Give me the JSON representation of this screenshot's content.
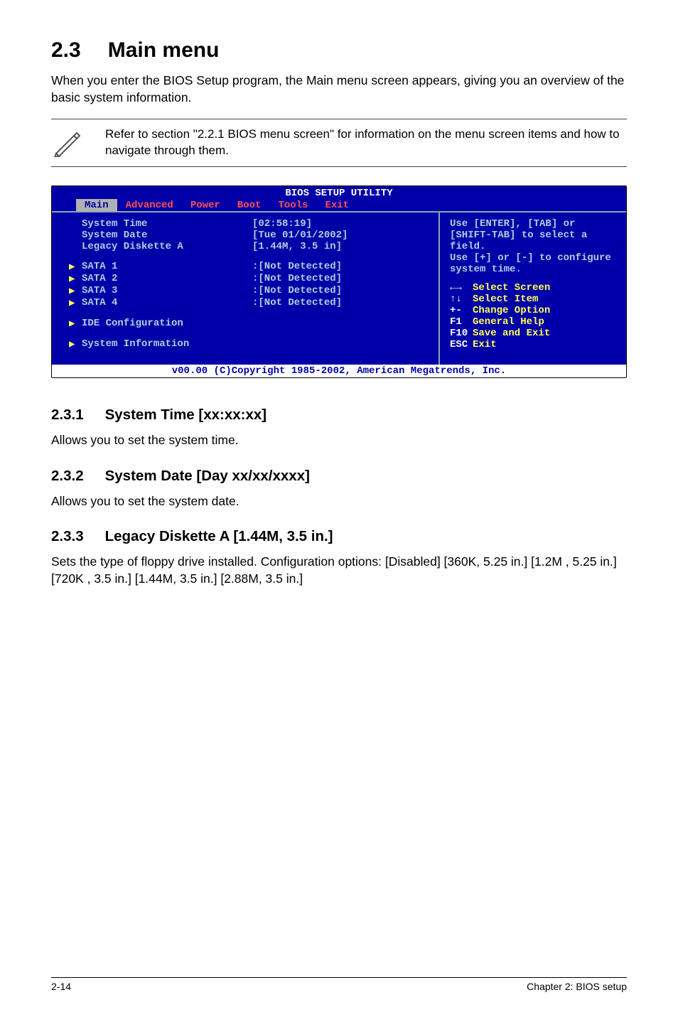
{
  "section": {
    "number": "2.3",
    "title": "Main menu"
  },
  "intro": "When you enter the BIOS Setup program, the Main menu screen appears, giving you an overview of the basic system information.",
  "note": "Refer to section \"2.2.1  BIOS menu screen\" for information on the menu screen items and how to navigate through them.",
  "bios": {
    "title": "BIOS SETUP UTILITY",
    "tabs": [
      "Main",
      "Advanced",
      "Power",
      "Boot",
      "Tools",
      "Exit"
    ],
    "active_tab": 0,
    "fields": {
      "system_time": {
        "label": "System Time",
        "value": "[02:58:19]"
      },
      "system_date": {
        "label": "System Date",
        "value": "[Tue 01/01/2002]"
      },
      "legacy_diskette_a": {
        "label": "Legacy Diskette A",
        "value": "[1.44M, 3.5 in]"
      }
    },
    "sata": [
      {
        "label": "SATA 1",
        "value": ":[Not Detected]"
      },
      {
        "label": "SATA 2",
        "value": ":[Not Detected]"
      },
      {
        "label": "SATA 3",
        "value": ":[Not Detected]"
      },
      {
        "label": "SATA 4",
        "value": ":[Not Detected]"
      }
    ],
    "submenus": {
      "ide_config": "IDE Configuration",
      "sys_info": "System Information"
    },
    "help_top": "Use [ENTER], [TAB] or [SHIFT-TAB] to select a field.\nUse [+] or [-] to configure system time.",
    "help_keys": [
      {
        "k": "←→",
        "a": "Select Screen"
      },
      {
        "k": "↑↓",
        "a": "Select Item"
      },
      {
        "k": "+-",
        "a": "Change Option"
      },
      {
        "k": "F1",
        "a": "General Help"
      },
      {
        "k": "F10",
        "a": "Save and Exit"
      },
      {
        "k": "ESC",
        "a": "Exit"
      }
    ],
    "footer": "v00.00 (C)Copyright 1985-2002, American Megatrends, Inc."
  },
  "subs": [
    {
      "num": "2.3.1",
      "title": "System Time [xx:xx:xx]",
      "body": "Allows you to set the system time."
    },
    {
      "num": "2.3.2",
      "title": "System Date [Day xx/xx/xxxx]",
      "body": "Allows you to set the system date."
    },
    {
      "num": "2.3.3",
      "title": "Legacy Diskette A [1.44M, 3.5 in.]",
      "body": "Sets the type of floppy drive installed. Configuration options: [Disabled] [360K, 5.25 in.] [1.2M , 5.25 in.] [720K , 3.5 in.] [1.44M, 3.5 in.] [2.88M, 3.5 in.]"
    }
  ],
  "page_footer": {
    "left": "2-14",
    "right": "Chapter 2: BIOS setup"
  }
}
